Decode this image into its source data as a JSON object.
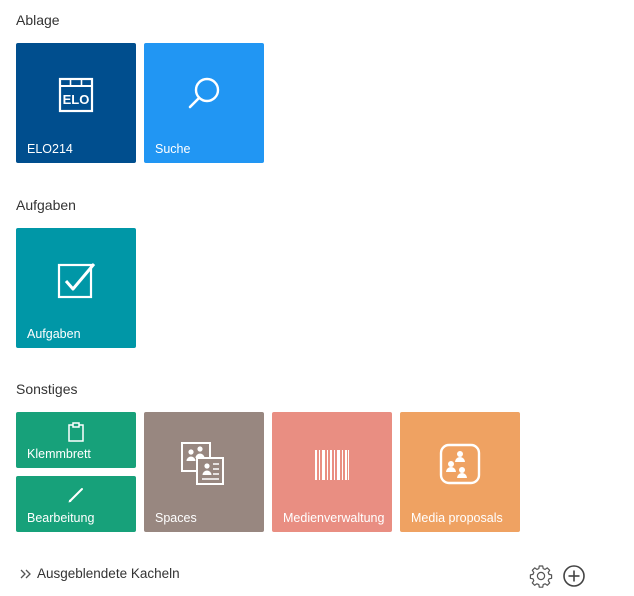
{
  "colors": {
    "elo_tile": "#004e8e",
    "search_tile": "#2196f3",
    "tasks_tile": "#0097a7",
    "clipboard_tile": "#17a17a",
    "edit_tile": "#17a17a",
    "spaces_tile": "#988780",
    "media_tile": "#e98e82",
    "proposals_tile": "#efa262"
  },
  "sections": {
    "ablage": {
      "title": "Ablage",
      "tiles": {
        "elo": "ELO214",
        "search": "Suche"
      },
      "icons": {
        "elo": "elo-logo-icon",
        "search": "search-icon"
      }
    },
    "aufgaben": {
      "title": "Aufgaben",
      "tiles": {
        "tasks": "Aufgaben"
      },
      "icons": {
        "tasks": "checkbox-icon"
      }
    },
    "sonstiges": {
      "title": "Sonstiges",
      "tiles": {
        "clipboard": "Klemmbrett",
        "edit": "Bearbeitung",
        "spaces": "Spaces",
        "media": "Medienverwaltung",
        "proposals": "Media proposals"
      },
      "icons": {
        "clipboard": "clipboard-icon",
        "edit": "pencil-icon",
        "spaces": "spaces-icon",
        "media": "barcode-icon",
        "proposals": "people-group-icon"
      }
    }
  },
  "footer": {
    "hidden_tiles_label": "Ausgeblendete Kacheln",
    "icons": {
      "chevron": "double-chevron-right-icon",
      "settings": "gear-icon",
      "add": "plus-circle-icon"
    }
  }
}
